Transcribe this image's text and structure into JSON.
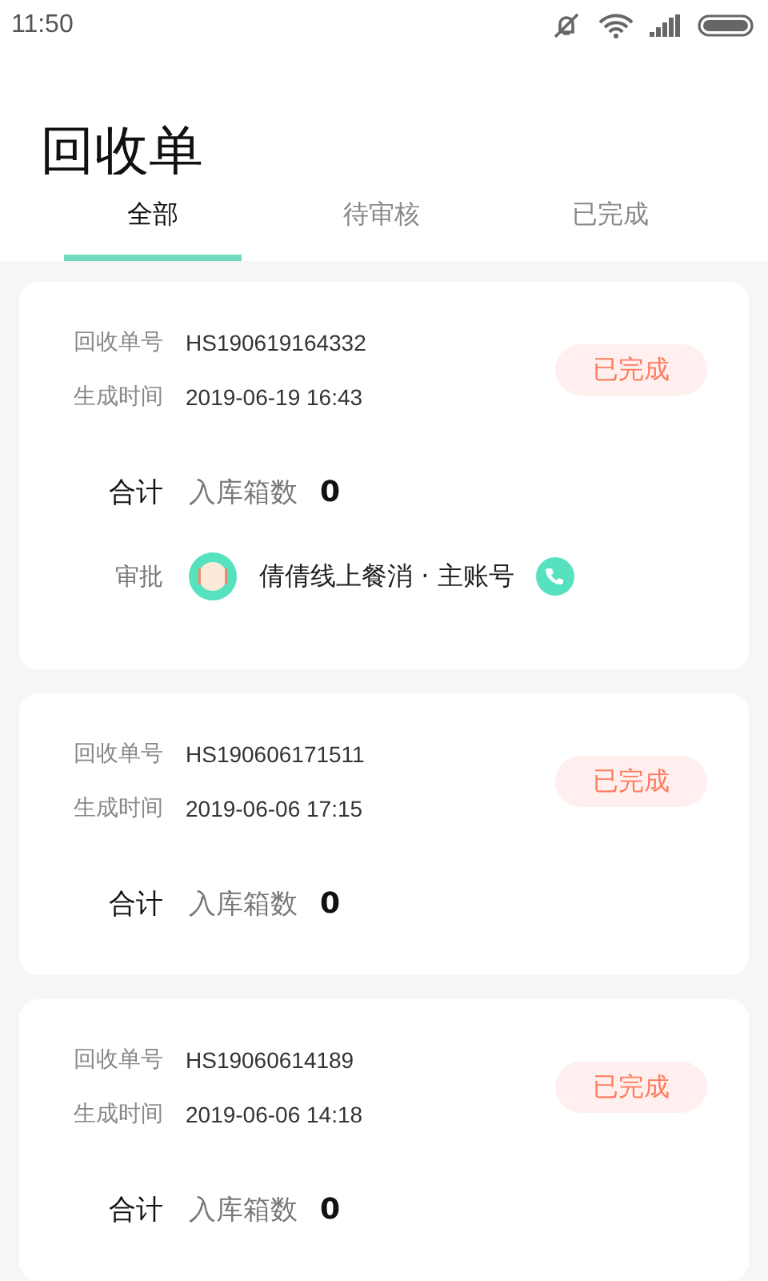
{
  "status_bar": {
    "time": "11:50"
  },
  "title": "回收单",
  "tabs": [
    {
      "label": "全部",
      "selected": true
    },
    {
      "label": "待审核",
      "selected": false
    },
    {
      "label": "已完成",
      "selected": false
    }
  ],
  "orders": [
    {
      "number_label": "回收单号",
      "number": "HS190619164332",
      "time_label": "生成时间",
      "time": "2019-06-19 16:43",
      "status": "已完成",
      "total_label": "合计",
      "count_label": "入库箱数",
      "count": "0",
      "approval_label": "审批",
      "approver": "倩倩线上餐消 · 主账号"
    },
    {
      "number_label": "回收单号",
      "number": "HS190606171511",
      "time_label": "生成时间",
      "time": "2019-06-06 17:15",
      "status": "已完成",
      "total_label": "合计",
      "count_label": "入库箱数",
      "count": "0"
    },
    {
      "number_label": "回收单号",
      "number": "HS19060614189",
      "time_label": "生成时间",
      "time": "2019-06-06 14:18",
      "status": "已完成",
      "total_label": "合计",
      "count_label": "入库箱数",
      "count": "0"
    }
  ]
}
